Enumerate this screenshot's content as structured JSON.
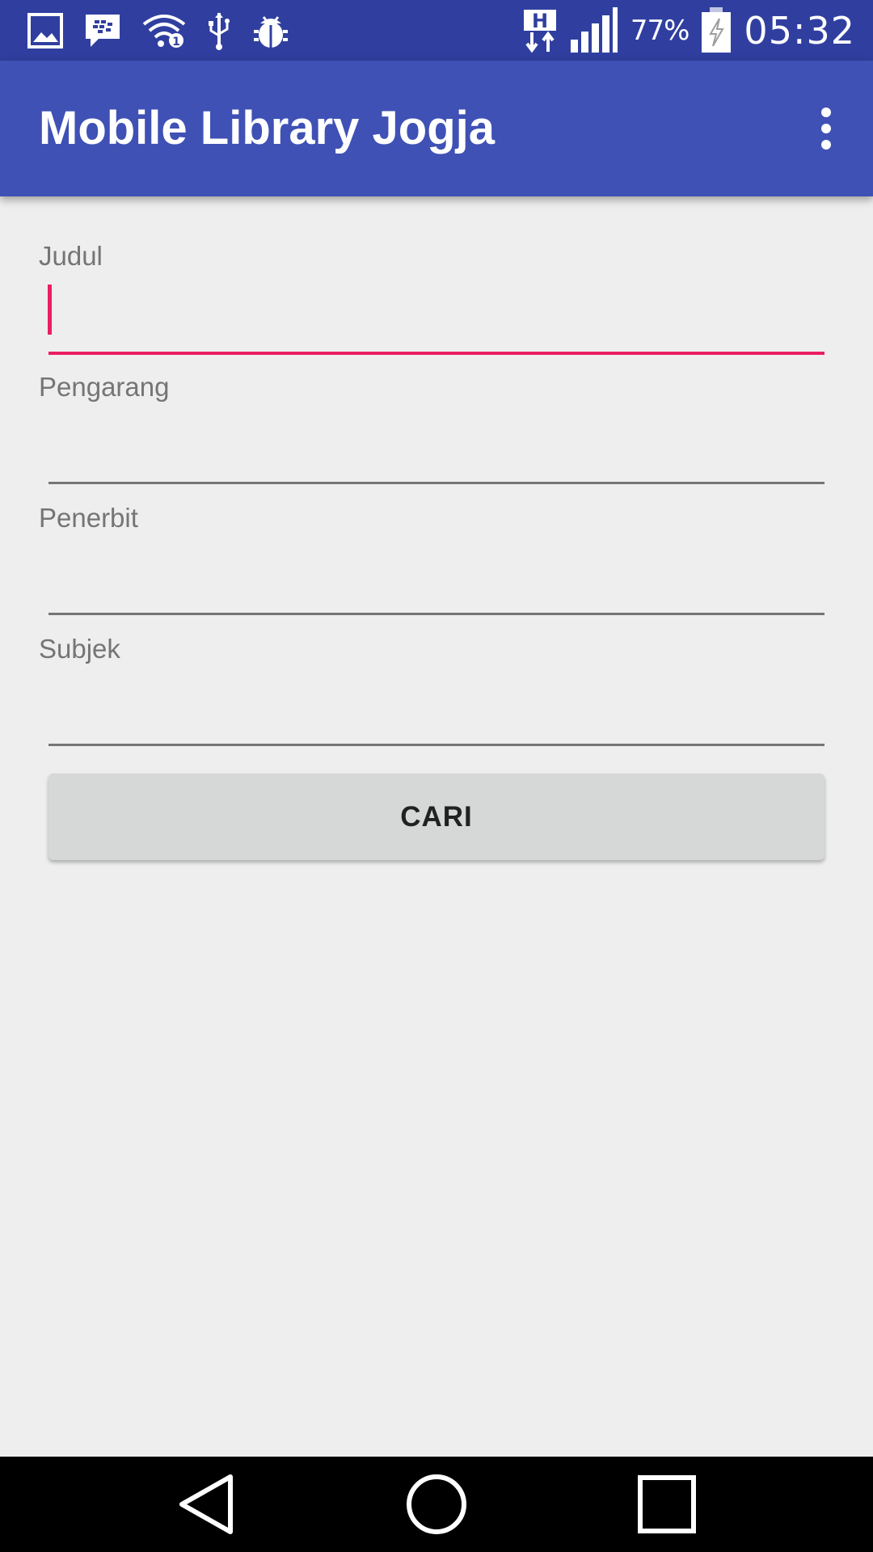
{
  "status_bar": {
    "left_icons": [
      "image-icon",
      "bbm-icon",
      "wifi-icon",
      "usb-icon",
      "android-debug-icon"
    ],
    "network_type": "H",
    "battery_percent": "77%",
    "time": "05:32"
  },
  "app_bar": {
    "title": "Mobile Library Jogja",
    "menu_icon": "more-vert-icon"
  },
  "form": {
    "fields": [
      {
        "label": "Judul",
        "value": "",
        "focused": true
      },
      {
        "label": "Pengarang",
        "value": "",
        "focused": false
      },
      {
        "label": "Penerbit",
        "value": "",
        "focused": false
      },
      {
        "label": "Subjek",
        "value": "",
        "focused": false
      }
    ],
    "search_button_label": "CARI"
  },
  "nav_bar": {
    "buttons": [
      "back-icon",
      "home-icon",
      "recents-icon"
    ]
  },
  "colors": {
    "status_bar": "#303f9f",
    "app_bar": "#3f51b5",
    "accent": "#e91e63",
    "background": "#eeeeee"
  }
}
